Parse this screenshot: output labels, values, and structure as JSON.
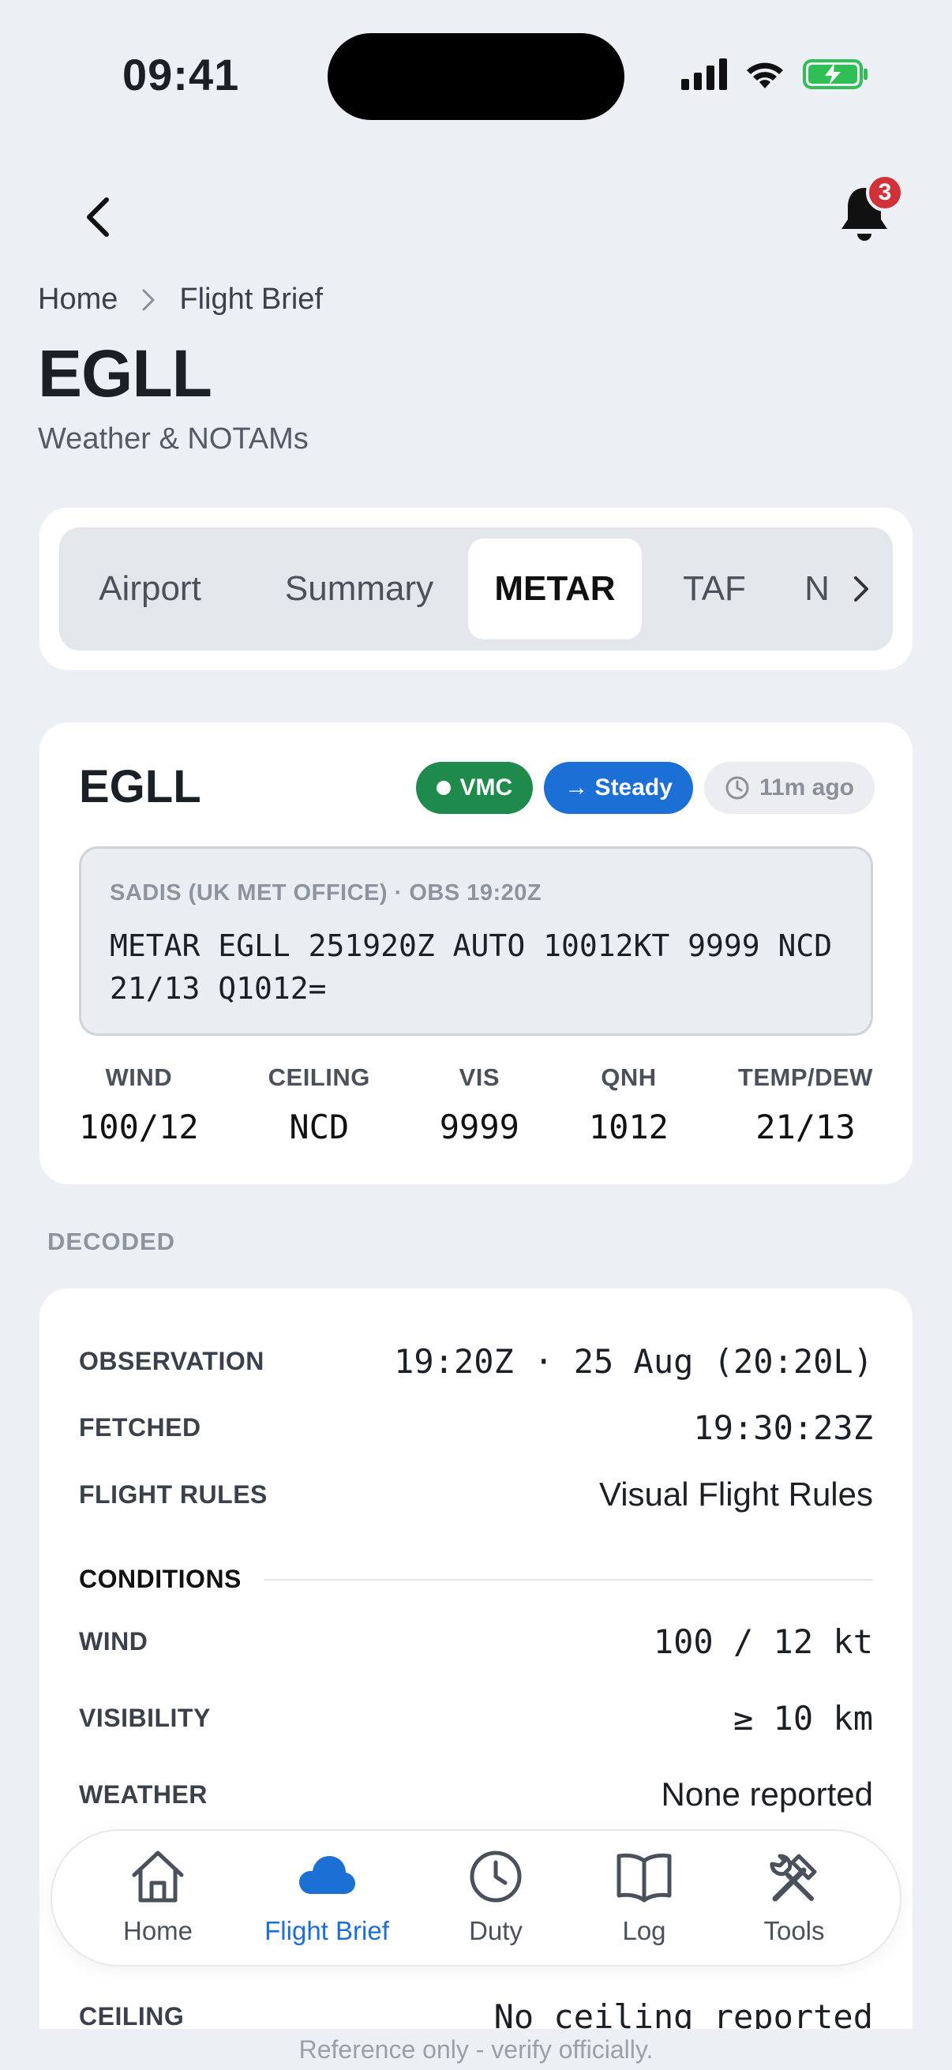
{
  "status_bar": {
    "time": "09:41"
  },
  "header": {
    "notification_count": "3",
    "breadcrumb": [
      "Home",
      "Flight Brief"
    ],
    "title": "EGLL",
    "subtitle": "Weather & NOTAMs"
  },
  "tabs": {
    "items": [
      "Airport",
      "Summary",
      "METAR",
      "TAF",
      "N"
    ],
    "active": "METAR"
  },
  "metar": {
    "station": "EGLL",
    "badges": {
      "rules": "VMC",
      "trend": "→ Steady",
      "age": "11m ago"
    },
    "source": "SADIS (UK MET OFFICE) · OBS 19:20Z",
    "raw": "METAR EGLL 251920Z AUTO 10012KT 9999 NCD 21/13 Q1012=",
    "stats": [
      {
        "label": "WIND",
        "value": "100/12"
      },
      {
        "label": "CEILING",
        "value": "NCD"
      },
      {
        "label": "VIS",
        "value": "9999"
      },
      {
        "label": "QNH",
        "value": "1012"
      },
      {
        "label": "TEMP/DEW",
        "value": "21/13"
      }
    ]
  },
  "decoded": {
    "section_label": "DECODED",
    "observation": {
      "label": "OBSERVATION",
      "value": "19:20Z · 25 Aug (20:20L)"
    },
    "fetched": {
      "label": "FETCHED",
      "value": "19:30:23Z"
    },
    "flight_rules": {
      "label": "FLIGHT RULES",
      "value": "Visual Flight Rules"
    },
    "conditions_label": "CONDITIONS",
    "wind": {
      "label": "WIND",
      "value": "100 / 12 kt"
    },
    "visibility": {
      "label": "VISIBILITY",
      "value": "≥ 10 km"
    },
    "weather": {
      "label": "WEATHER",
      "value": "None reported"
    },
    "ceiling": {
      "label": "CEILING",
      "value": "No ceiling reported"
    }
  },
  "bottom_nav": {
    "items": [
      "Home",
      "Flight Brief",
      "Duty",
      "Log",
      "Tools"
    ],
    "active": "Flight Brief"
  },
  "footer_note": "Reference only - verify officially.",
  "colors": {
    "accent": "#1c6fd4",
    "vmc_green": "#1e8a4c",
    "badge_red": "#d1323a",
    "background": "#eceff3"
  },
  "icons": [
    "back-chevron-icon",
    "bell-icon",
    "chevron-right-icon",
    "clock-icon",
    "home-icon",
    "cloud-icon",
    "book-icon",
    "tools-icon"
  ]
}
